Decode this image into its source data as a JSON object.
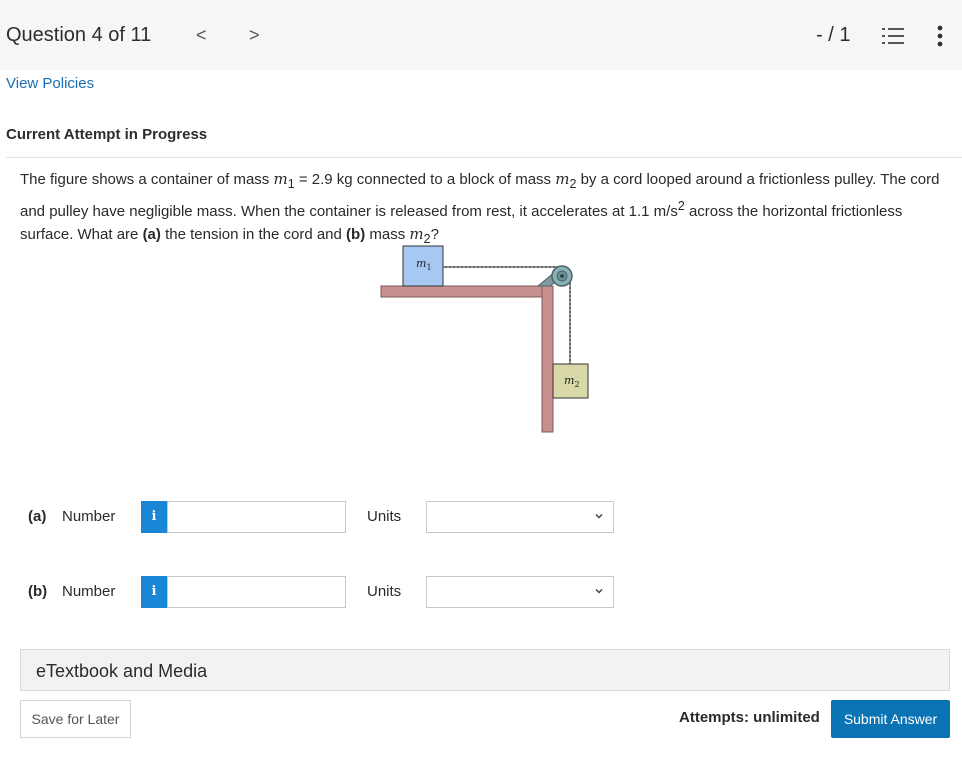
{
  "header": {
    "question_counter": "Question 4 of 11",
    "prev_label": "<",
    "next_label": ">",
    "score": "- / 1"
  },
  "links": {
    "view_policies": "View Policies"
  },
  "attempt_heading": "Current Attempt in Progress",
  "question": {
    "text_1": "The figure shows a container of mass ",
    "m1": "m",
    "m1_sub": "1",
    "text_2": " = 2.9 kg connected to a block of mass ",
    "m2": "m",
    "m2_sub": "2",
    "text_3": " by a cord looped around a frictionless pulley. The cord and pulley have negligible mass. When the container is released from rest, it accelerates at 1.1 m/s",
    "sup": "2",
    "text_4": " across the horizontal frictionless surface. What are ",
    "part_a": "(a)",
    "text_5": " the tension in the cord and ",
    "part_b": "(b)",
    "text_6": " mass ",
    "m2b": "m",
    "m2b_sub": "2",
    "text_7": "?"
  },
  "figure": {
    "m1_label": "m",
    "m1_sub": "1",
    "m2_label": "m",
    "m2_sub": "2",
    "colors": {
      "table": "#c88f8f",
      "block_m1": "#a7c8f2",
      "block_m2": "#d8d8a8",
      "pulley": "#8ab0b8"
    }
  },
  "answers": [
    {
      "part": "(a)",
      "label": "Number",
      "info": "i",
      "value": "",
      "units_label": "Units",
      "units_value": ""
    },
    {
      "part": "(b)",
      "label": "Number",
      "info": "i",
      "value": "",
      "units_label": "Units",
      "units_value": ""
    }
  ],
  "etextbook": "eTextbook and Media",
  "footer": {
    "save_later": "Save for Later",
    "attempts": "Attempts: unlimited",
    "submit": "Submit Answer"
  },
  "icons": [
    "chevron-left-icon",
    "chevron-right-icon",
    "list-icon",
    "more-vertical-icon",
    "info-icon",
    "chevron-down-icon"
  ],
  "colors": {
    "accent": "#0a73b4",
    "info": "#1a86d6",
    "link": "#1a6fb4",
    "topbar": "#f6f6f6"
  }
}
